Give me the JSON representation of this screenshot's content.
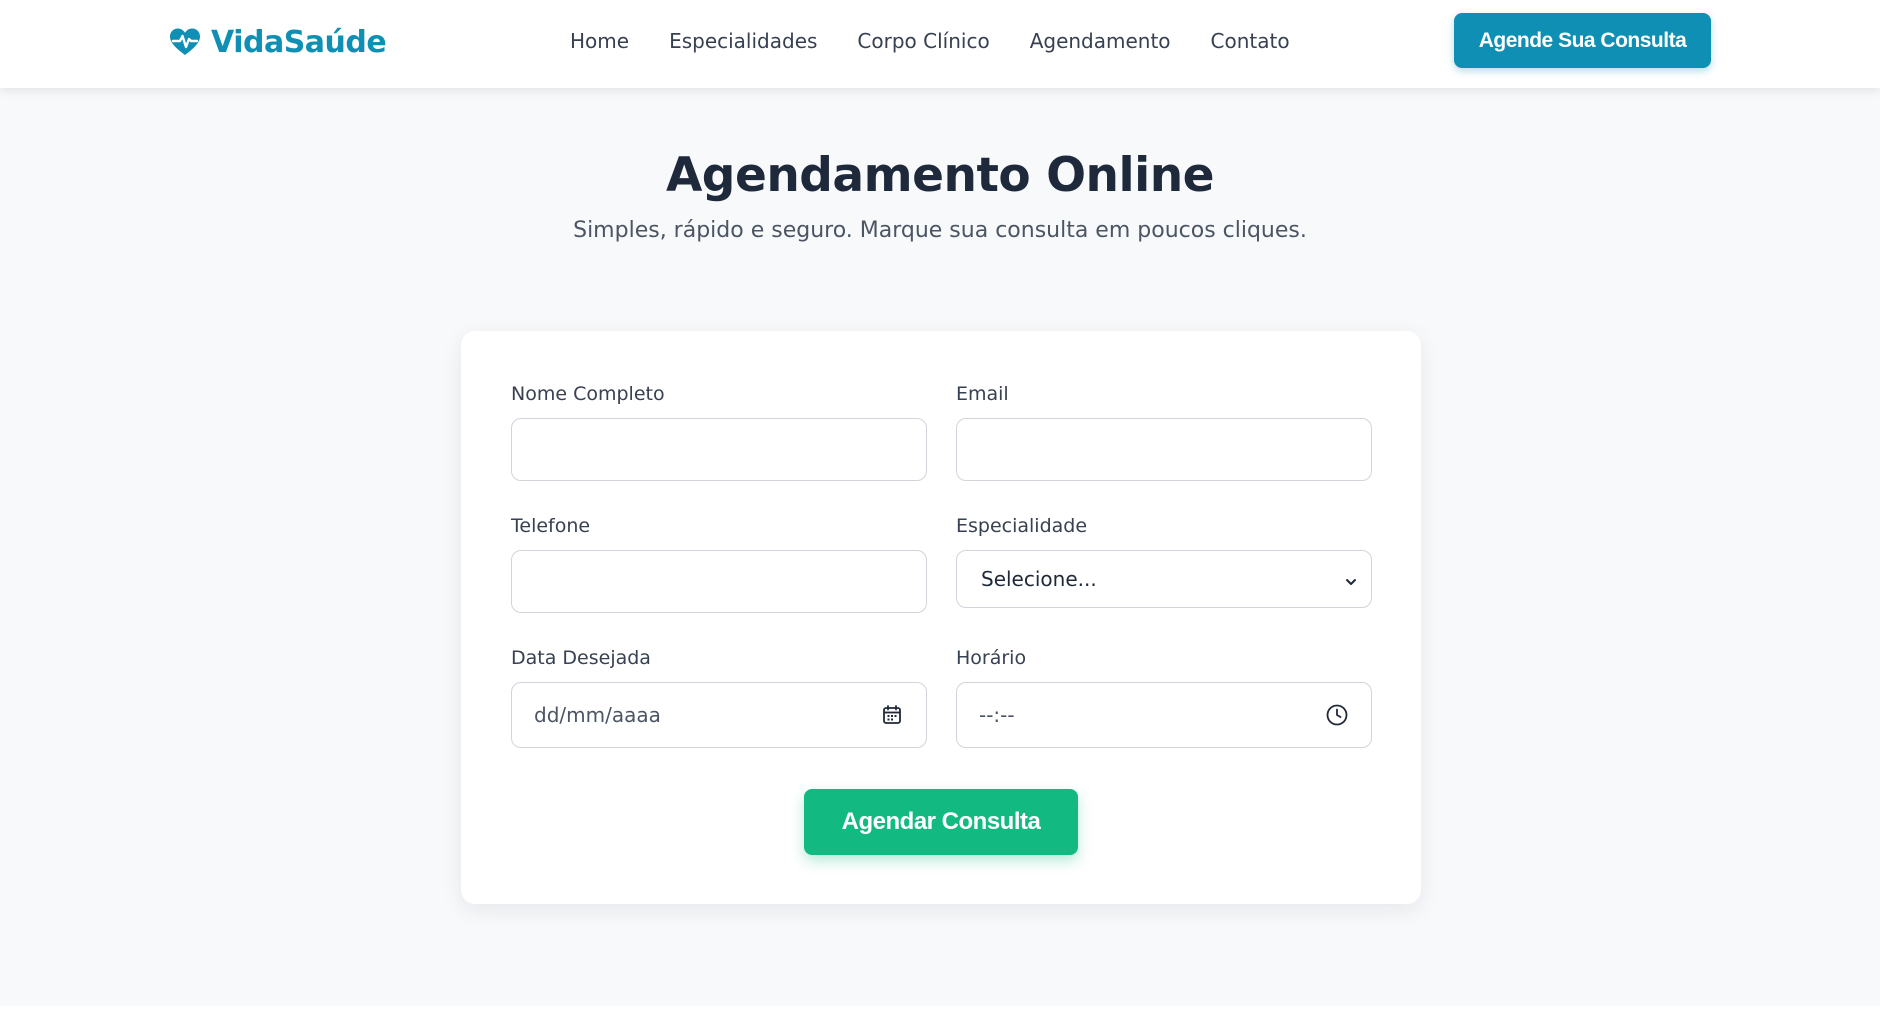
{
  "header": {
    "logo_text": "VidaSaúde",
    "logo_icon": "heart-pulse-icon",
    "nav": [
      {
        "label": "Home"
      },
      {
        "label": "Especialidades"
      },
      {
        "label": "Corpo Clínico"
      },
      {
        "label": "Agendamento"
      },
      {
        "label": "Contato"
      }
    ],
    "cta_label": "Agende Sua Consulta"
  },
  "main": {
    "title": "Agendamento Online",
    "subtitle": "Simples, rápido e seguro. Marque sua consulta em poucos cliques."
  },
  "form": {
    "name_label": "Nome Completo",
    "name_value": "",
    "email_label": "Email",
    "email_value": "",
    "phone_label": "Telefone",
    "phone_value": "",
    "specialty_label": "Especialidade",
    "specialty_selected": "Selecione...",
    "date_label": "Data Desejada",
    "date_placeholder": "dd/mm/aaaa",
    "time_label": "Horário",
    "time_placeholder": "--:--",
    "submit_label": "Agendar Consulta"
  },
  "colors": {
    "brand": "#0e8fb3",
    "submit": "#12b981",
    "heading": "#1e293b",
    "background": "#f8f9fb"
  }
}
